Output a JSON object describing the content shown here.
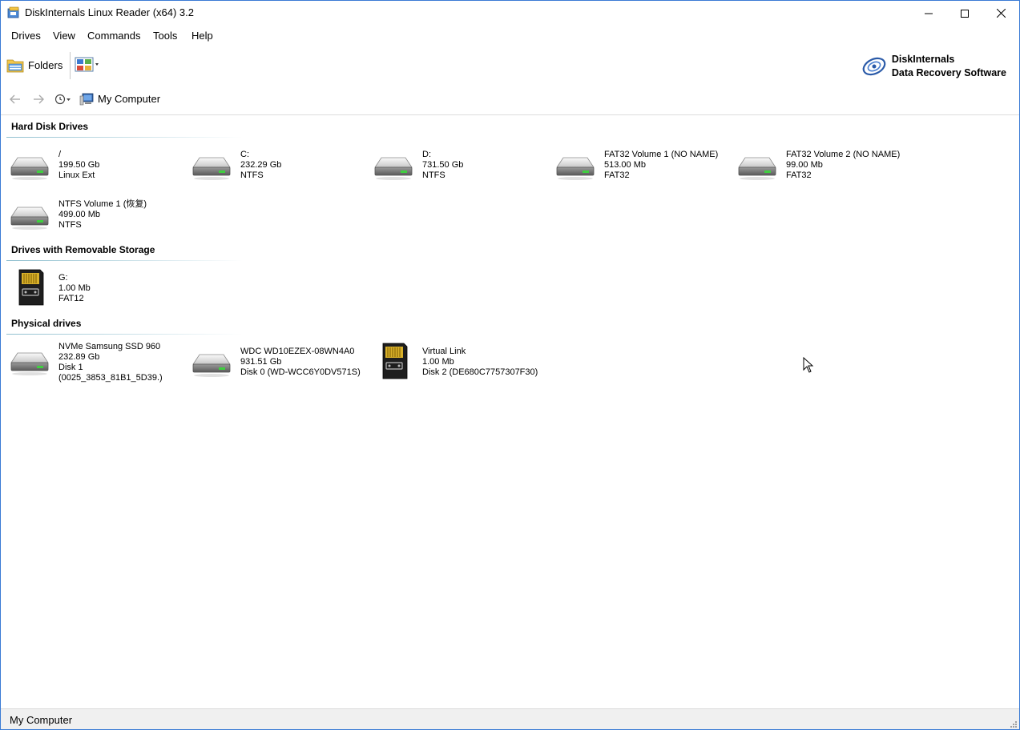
{
  "window": {
    "title": "DiskInternals Linux Reader (x64) 3.2"
  },
  "menu": [
    "Drives",
    "View",
    "Commands",
    "Tools",
    "Help"
  ],
  "toolbar": {
    "folders_label": "Folders"
  },
  "brand": {
    "line1": "DiskInternals",
    "line2": "Data Recovery Software"
  },
  "nav": {
    "path": "My Computer"
  },
  "sections": {
    "hard_disk_drives": {
      "title": "Hard Disk Drives",
      "items": [
        {
          "name": "/",
          "size": "199.50 Gb",
          "fs": "Linux Ext",
          "icon": "hdd-icon"
        },
        {
          "name": "C:",
          "size": "232.29 Gb",
          "fs": "NTFS",
          "icon": "hdd-icon"
        },
        {
          "name": "D:",
          "size": "731.50 Gb",
          "fs": "NTFS",
          "icon": "hdd-icon"
        },
        {
          "name": "FAT32 Volume 1 (NO NAME)",
          "size": "513.00 Mb",
          "fs": "FAT32",
          "icon": "hdd-icon"
        },
        {
          "name": "FAT32 Volume 2 (NO NAME)",
          "size": "99.00 Mb",
          "fs": "FAT32",
          "icon": "hdd-icon"
        },
        {
          "name": "NTFS Volume 1 (恢复)",
          "size": "499.00 Mb",
          "fs": "NTFS",
          "icon": "hdd-icon"
        }
      ]
    },
    "removable": {
      "title": "Drives with Removable Storage",
      "items": [
        {
          "name": "G:",
          "size": "1.00 Mb",
          "fs": "FAT12",
          "icon": "sd-card-icon"
        }
      ]
    },
    "physical": {
      "title": "Physical drives",
      "items": [
        {
          "name": "NVMe Samsung SSD 960",
          "size": "232.89 Gb",
          "fs": "Disk 1",
          "extra": "(0025_3853_81B1_5D39.)",
          "icon": "hdd-icon"
        },
        {
          "name": "WDC WD10EZEX-08WN4A0",
          "size": "931.51 Gb",
          "fs": "Disk 0 (WD-WCC6Y0DV571S)",
          "icon": "hdd-icon"
        },
        {
          "name": "Virtual Link",
          "size": "1.00 Mb",
          "fs": "Disk 2 (DE680C7757307F30)",
          "icon": "sd-card-icon"
        }
      ]
    }
  },
  "status": {
    "text": "My Computer"
  }
}
